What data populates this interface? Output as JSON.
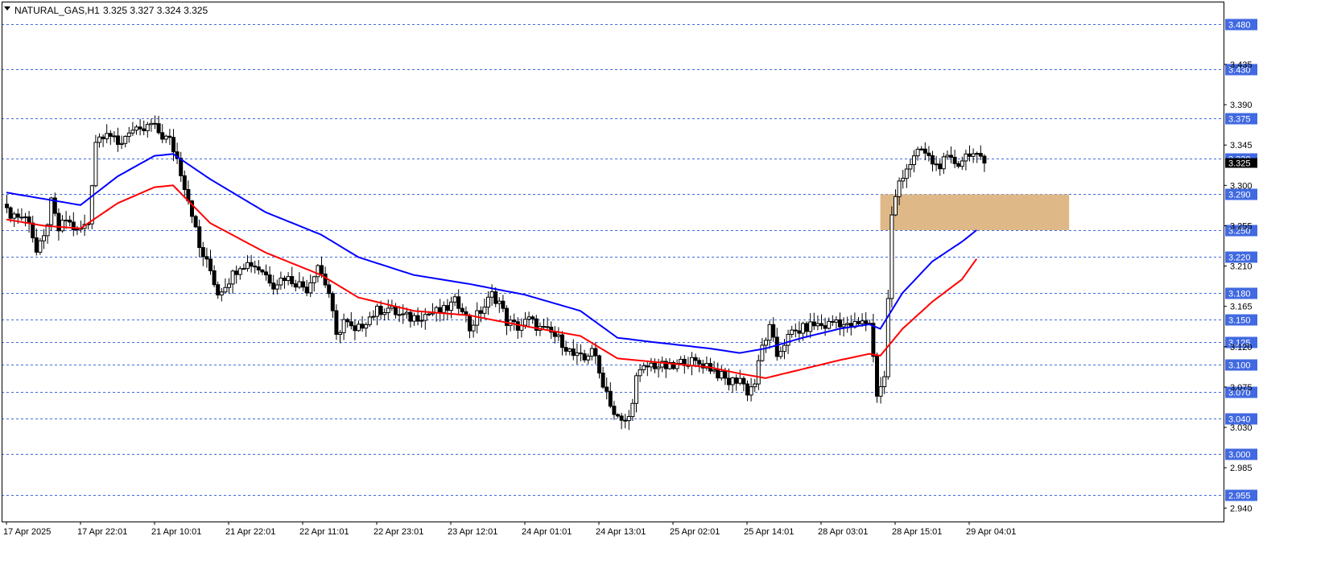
{
  "header": {
    "symbol": "NATURAL_GAS,H1",
    "ohlc": "3.325 3.327 3.324 3.325",
    "menu_icon": "triangle-down-icon"
  },
  "colors": {
    "background": "#ffffff",
    "axis": "#000000",
    "bull_candle": "#ffffff",
    "bear_candle": "#000000",
    "ma_fast": "#0000ff",
    "ma_slow": "#ff0000",
    "level_line": "#4169e1",
    "level_label_bg": "#4169e1",
    "zone_fill": "#deb887"
  },
  "chart_data": {
    "type": "candlestick",
    "title": "NATURAL_GAS,H1",
    "timeframe": "H1",
    "ylim": [
      2.925,
      3.505
    ],
    "grid": false,
    "y_ticks": [
      "3.435",
      "3.390",
      "3.345",
      "3.300",
      "3.255",
      "3.210",
      "3.165",
      "3.120",
      "3.075",
      "3.030",
      "2.985",
      "2.940"
    ],
    "x_ticks": [
      {
        "label": "17 Apr 2025",
        "index": 0
      },
      {
        "label": "17 Apr 22:01",
        "index": 20
      },
      {
        "label": "21 Apr 10:01",
        "index": 40
      },
      {
        "label": "21 Apr 22:01",
        "index": 60
      },
      {
        "label": "22 Apr 11:01",
        "index": 80
      },
      {
        "label": "22 Apr 23:01",
        "index": 100
      },
      {
        "label": "23 Apr 12:01",
        "index": 120
      },
      {
        "label": "24 Apr 01:01",
        "index": 140
      },
      {
        "label": "24 Apr 13:01",
        "index": 160
      },
      {
        "label": "25 Apr 02:01",
        "index": 180
      },
      {
        "label": "25 Apr 14:01",
        "index": 200
      },
      {
        "label": "28 Apr 03:01",
        "index": 220
      },
      {
        "label": "28 Apr 15:01",
        "index": 240
      },
      {
        "label": "29 Apr 04:01",
        "index": 260
      }
    ],
    "horizontal_levels": [
      "3.480",
      "3.430",
      "3.375",
      "3.330",
      "3.290",
      "3.250",
      "3.220",
      "3.180",
      "3.150",
      "3.125",
      "3.100",
      "3.070",
      "3.040",
      "3.000",
      "2.955"
    ],
    "current_price": "3.325",
    "zone": {
      "from_index": 236,
      "to_index": 287,
      "low": 3.25,
      "high": 3.29
    },
    "candle_anchors": [
      [
        0,
        3.27
      ],
      [
        6,
        3.262
      ],
      [
        8,
        3.225
      ],
      [
        10,
        3.24
      ],
      [
        12,
        3.28
      ],
      [
        14,
        3.25
      ],
      [
        16,
        3.262
      ],
      [
        19,
        3.248
      ],
      [
        22,
        3.258
      ],
      [
        24,
        3.35
      ],
      [
        27,
        3.362
      ],
      [
        30,
        3.343
      ],
      [
        33,
        3.362
      ],
      [
        36,
        3.358
      ],
      [
        39,
        3.368
      ],
      [
        42,
        3.355
      ],
      [
        44,
        3.35
      ],
      [
        46,
        3.33
      ],
      [
        48,
        3.3
      ],
      [
        50,
        3.27
      ],
      [
        52,
        3.23
      ],
      [
        55,
        3.205
      ],
      [
        57,
        3.18
      ],
      [
        60,
        3.195
      ],
      [
        63,
        3.212
      ],
      [
        66,
        3.213
      ],
      [
        69,
        3.205
      ],
      [
        72,
        3.19
      ],
      [
        75,
        3.198
      ],
      [
        78,
        3.192
      ],
      [
        81,
        3.185
      ],
      [
        84,
        3.212
      ],
      [
        87,
        3.18
      ],
      [
        89,
        3.13
      ],
      [
        91,
        3.15
      ],
      [
        94,
        3.135
      ],
      [
        97,
        3.15
      ],
      [
        100,
        3.16
      ],
      [
        103,
        3.163
      ],
      [
        106,
        3.155
      ],
      [
        109,
        3.152
      ],
      [
        112,
        3.155
      ],
      [
        115,
        3.158
      ],
      [
        118,
        3.16
      ],
      [
        121,
        3.17
      ],
      [
        123,
        3.165
      ],
      [
        125,
        3.14
      ],
      [
        127,
        3.155
      ],
      [
        129,
        3.165
      ],
      [
        131,
        3.178
      ],
      [
        133,
        3.17
      ],
      [
        135,
        3.148
      ],
      [
        138,
        3.142
      ],
      [
        141,
        3.15
      ],
      [
        144,
        3.14
      ],
      [
        147,
        3.135
      ],
      [
        150,
        3.125
      ],
      [
        153,
        3.11
      ],
      [
        156,
        3.105
      ],
      [
        158,
        3.12
      ],
      [
        160,
        3.09
      ],
      [
        162,
        3.07
      ],
      [
        164,
        3.045
      ],
      [
        166,
        3.035
      ],
      [
        168,
        3.04
      ],
      [
        170,
        3.085
      ],
      [
        172,
        3.095
      ],
      [
        174,
        3.1
      ],
      [
        177,
        3.098
      ],
      [
        180,
        3.096
      ],
      [
        183,
        3.105
      ],
      [
        186,
        3.102
      ],
      [
        189,
        3.1
      ],
      [
        192,
        3.09
      ],
      [
        195,
        3.08
      ],
      [
        198,
        3.085
      ],
      [
        200,
        3.07
      ],
      [
        202,
        3.08
      ],
      [
        204,
        3.12
      ],
      [
        206,
        3.14
      ],
      [
        208,
        3.11
      ],
      [
        210,
        3.125
      ],
      [
        212,
        3.135
      ],
      [
        215,
        3.14
      ],
      [
        218,
        3.145
      ],
      [
        221,
        3.143
      ],
      [
        224,
        3.15
      ],
      [
        227,
        3.142
      ],
      [
        230,
        3.145
      ],
      [
        233,
        3.148
      ],
      [
        235,
        3.068
      ],
      [
        237,
        3.085
      ],
      [
        239,
        3.265
      ],
      [
        241,
        3.305
      ],
      [
        243,
        3.32
      ],
      [
        245,
        3.33
      ],
      [
        247,
        3.34
      ],
      [
        249,
        3.33
      ],
      [
        251,
        3.322
      ],
      [
        254,
        3.328
      ],
      [
        257,
        3.325
      ],
      [
        260,
        3.338
      ],
      [
        262,
        3.33
      ],
      [
        264,
        3.325
      ]
    ],
    "ma_fast": {
      "name": "",
      "anchors": [
        [
          0,
          3.292
        ],
        [
          10,
          3.285
        ],
        [
          20,
          3.278
        ],
        [
          30,
          3.31
        ],
        [
          40,
          3.333
        ],
        [
          45,
          3.335
        ],
        [
          55,
          3.307
        ],
        [
          70,
          3.27
        ],
        [
          85,
          3.245
        ],
        [
          95,
          3.22
        ],
        [
          110,
          3.2
        ],
        [
          125,
          3.19
        ],
        [
          140,
          3.178
        ],
        [
          155,
          3.16
        ],
        [
          165,
          3.13
        ],
        [
          175,
          3.125
        ],
        [
          190,
          3.118
        ],
        [
          198,
          3.113
        ],
        [
          205,
          3.118
        ],
        [
          215,
          3.13
        ],
        [
          225,
          3.14
        ],
        [
          233,
          3.145
        ],
        [
          236,
          3.14
        ],
        [
          242,
          3.18
        ],
        [
          250,
          3.215
        ],
        [
          258,
          3.237
        ],
        [
          262,
          3.25
        ]
      ]
    },
    "ma_slow": {
      "name": "",
      "anchors": [
        [
          0,
          3.262
        ],
        [
          10,
          3.255
        ],
        [
          20,
          3.252
        ],
        [
          30,
          3.28
        ],
        [
          40,
          3.298
        ],
        [
          45,
          3.3
        ],
        [
          55,
          3.258
        ],
        [
          70,
          3.225
        ],
        [
          85,
          3.2
        ],
        [
          95,
          3.175
        ],
        [
          110,
          3.16
        ],
        [
          125,
          3.155
        ],
        [
          140,
          3.143
        ],
        [
          155,
          3.132
        ],
        [
          165,
          3.107
        ],
        [
          175,
          3.103
        ],
        [
          190,
          3.097
        ],
        [
          198,
          3.09
        ],
        [
          205,
          3.085
        ],
        [
          215,
          3.095
        ],
        [
          225,
          3.105
        ],
        [
          233,
          3.112
        ],
        [
          236,
          3.11
        ],
        [
          242,
          3.14
        ],
        [
          250,
          3.17
        ],
        [
          258,
          3.195
        ],
        [
          262,
          3.218
        ]
      ]
    }
  }
}
